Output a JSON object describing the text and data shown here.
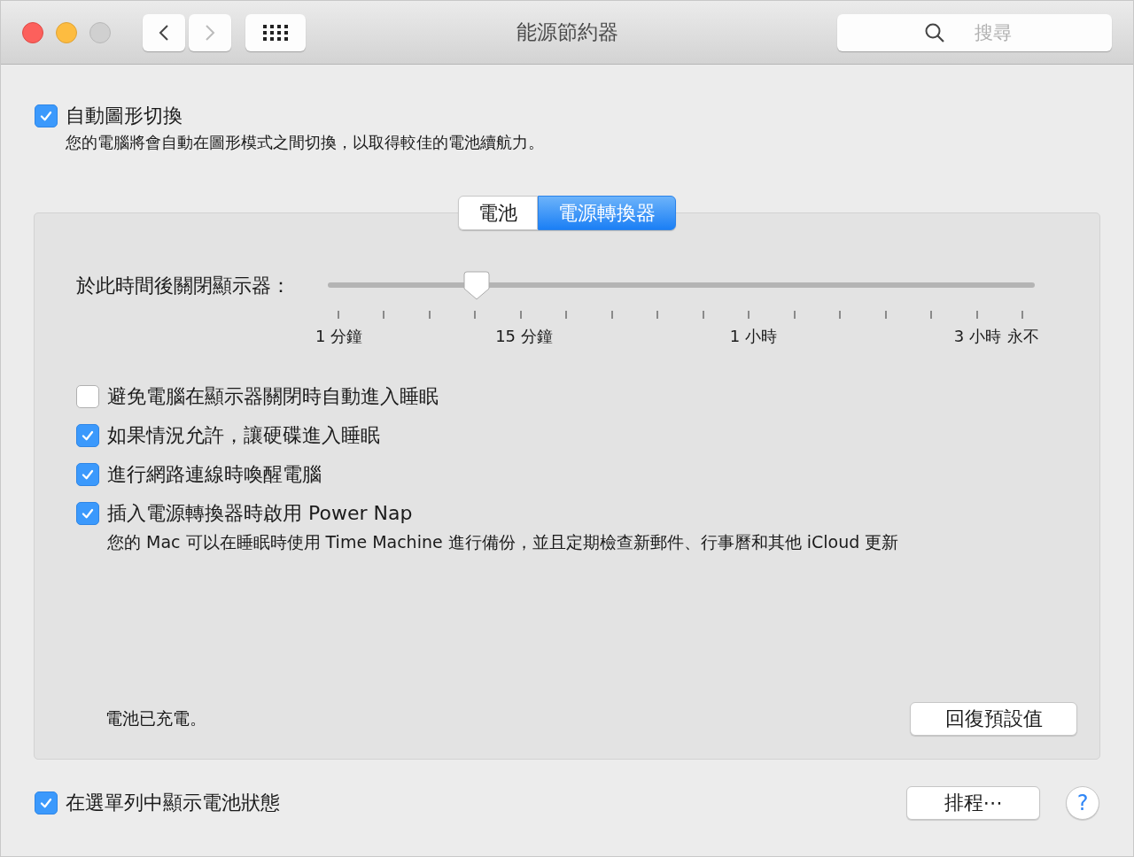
{
  "window": {
    "title": "能源節約器"
  },
  "search": {
    "placeholder": "搜尋"
  },
  "top_option": {
    "label": "自動圖形切換",
    "checked": true,
    "description": "您的電腦將會自動在圖形模式之間切換，以取得較佳的電池續航力。"
  },
  "tabs": [
    {
      "label": "電池",
      "selected": false
    },
    {
      "label": "電源轉換器",
      "selected": true
    }
  ],
  "display_sleep": {
    "label": "於此時間後關閉顯示器：",
    "level": 0.21,
    "tick_labels": [
      "1 分鐘",
      "15 分鐘",
      "1 小時",
      "3 小時",
      "永不"
    ]
  },
  "options": [
    {
      "label": "避免電腦在顯示器關閉時自動進入睡眠",
      "checked": false
    },
    {
      "label": "如果情況允許，讓硬碟進入睡眠",
      "checked": true
    },
    {
      "label": "進行網路連線時喚醒電腦",
      "checked": true
    },
    {
      "label": "插入電源轉換器時啟用 Power Nap",
      "checked": true,
      "description": "您的 Mac 可以在睡眠時使用 Time Machine 進行備份，並且定期檢查新郵件、行事曆和其他 iCloud 更新"
    }
  ],
  "battery_status": "電池已充電。",
  "restore_button": "回復預設值",
  "menu_bar_option": {
    "label": "在選單列中顯示電池狀態",
    "checked": true
  },
  "schedule_button": "排程⋯",
  "help_button": "?"
}
